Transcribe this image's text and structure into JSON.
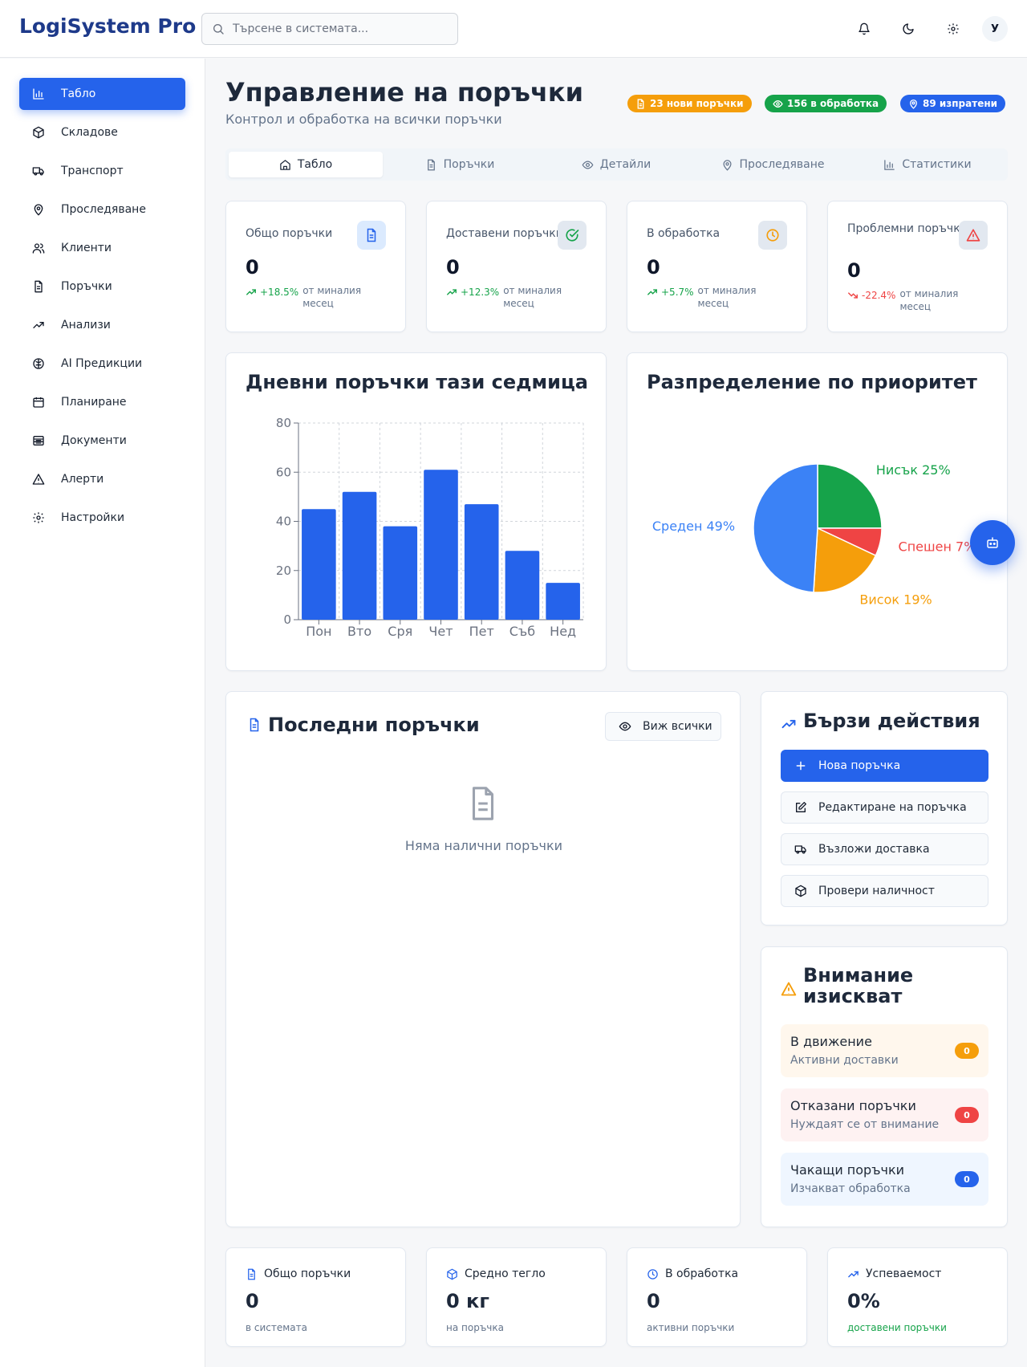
{
  "app": {
    "brand": "LogiSystem Pro",
    "avatar_initial": "У"
  },
  "search": {
    "placeholder": "Търсене в системата..."
  },
  "sidebar": {
    "items": [
      {
        "label": "Табло",
        "icon": "bar-chart-icon",
        "active": true
      },
      {
        "label": "Складове",
        "icon": "package-icon"
      },
      {
        "label": "Транспорт",
        "icon": "truck-icon"
      },
      {
        "label": "Проследяване",
        "icon": "map-pin-icon"
      },
      {
        "label": "Клиенти",
        "icon": "users-icon"
      },
      {
        "label": "Поръчки",
        "icon": "file-icon"
      },
      {
        "label": "Анализи",
        "icon": "trending-up-icon"
      },
      {
        "label": "AI Предикции",
        "icon": "brain-icon"
      },
      {
        "label": "Планиране",
        "icon": "calendar-icon"
      },
      {
        "label": "Документи",
        "icon": "archive-icon"
      },
      {
        "label": "Алерти",
        "icon": "warning-icon"
      },
      {
        "label": "Настройки",
        "icon": "gear-icon"
      }
    ]
  },
  "page": {
    "title": "Управление на поръчки",
    "subtitle": "Контрол и обработка на всички поръчки"
  },
  "badges": [
    {
      "label": "23 нови поръчки",
      "color": "#f59e0b"
    },
    {
      "label": "156 в обработка",
      "color": "#16a34a"
    },
    {
      "label": "89 изпратени",
      "color": "#2563eb"
    }
  ],
  "tabs": [
    "Табло",
    "Поръчки",
    "Детайли",
    "Проследяване",
    "Статистики"
  ],
  "stats": [
    {
      "label": "Общо поръчки",
      "value": "0",
      "trend": "+18.5%",
      "note": "от миналия месец",
      "dir": "up"
    },
    {
      "label": "Доставени поръчки",
      "value": "0",
      "trend": "+12.3%",
      "note": "от миналия месец",
      "dir": "up"
    },
    {
      "label": "В обработка",
      "value": "0",
      "trend": "+5.7%",
      "note": "от миналия месец",
      "dir": "up"
    },
    {
      "label": "Проблемни поръчки",
      "value": "0",
      "trend": "-22.4%",
      "note": "от миналия месец",
      "dir": "down"
    }
  ],
  "charts": {
    "daily_title": "Дневни поръчки тази седмица",
    "priority_title": "Разпределение по приоритет"
  },
  "chart_data": [
    {
      "type": "bar",
      "title": "Дневни поръчки тази седмица",
      "categories": [
        "Пон",
        "Вто",
        "Сря",
        "Чет",
        "Пет",
        "Съб",
        "Нед"
      ],
      "values": [
        45,
        52,
        38,
        61,
        47,
        28,
        15
      ],
      "yticks": [
        "0",
        "20",
        "40",
        "60",
        "80"
      ],
      "ylim": [
        0,
        80
      ],
      "grid": true,
      "color": "#2563eb"
    },
    {
      "type": "pie",
      "title": "Разпределение по приоритет",
      "slices": [
        {
          "name": "Нисък",
          "value": 25,
          "label": "Нисък 25%",
          "color": "#16a34a"
        },
        {
          "name": "Спешен",
          "value": 7,
          "label": "Спешен 7%",
          "color": "#ef4444"
        },
        {
          "name": "Висок",
          "value": 19,
          "label": "Висок 19%",
          "color": "#f59e0b"
        },
        {
          "name": "Среден",
          "value": 49,
          "label": "Среден 49%",
          "color": "#3b82f6"
        }
      ]
    }
  ],
  "recent": {
    "title": "Последни поръчки",
    "view_all": "Виж всички",
    "empty": "Няма налични поръчки"
  },
  "quick_actions": {
    "title": "Бързи действия",
    "items": [
      "Нова поръчка",
      "Редактиране на поръчка",
      "Възложи доставка",
      "Провери наличност"
    ]
  },
  "attention": {
    "title": "Внимание изискват",
    "items": [
      {
        "title": "В движение",
        "subtitle": "Активни доставки",
        "count": "0",
        "bg": "#fff7ed",
        "badge": "#f59e0b"
      },
      {
        "title": "Отказани поръчки",
        "subtitle": "Нуждаят се от внимание",
        "count": "0",
        "bg": "#fef2f2",
        "badge": "#ef4444"
      },
      {
        "title": "Чакащи поръчки",
        "subtitle": "Изчакват обработка",
        "count": "0",
        "bg": "#eff6ff",
        "badge": "#2563eb"
      }
    ]
  },
  "bottom_stats": [
    {
      "label": "Общо поръчки",
      "value": "0",
      "note": "в системата"
    },
    {
      "label": "Средно тегло",
      "value": "0 кг",
      "note": "на поръчка"
    },
    {
      "label": "В обработка",
      "value": "0",
      "note": "активни поръчки"
    },
    {
      "label": "Успеваемост",
      "value": "0%",
      "note": "доставени поръчки"
    }
  ]
}
